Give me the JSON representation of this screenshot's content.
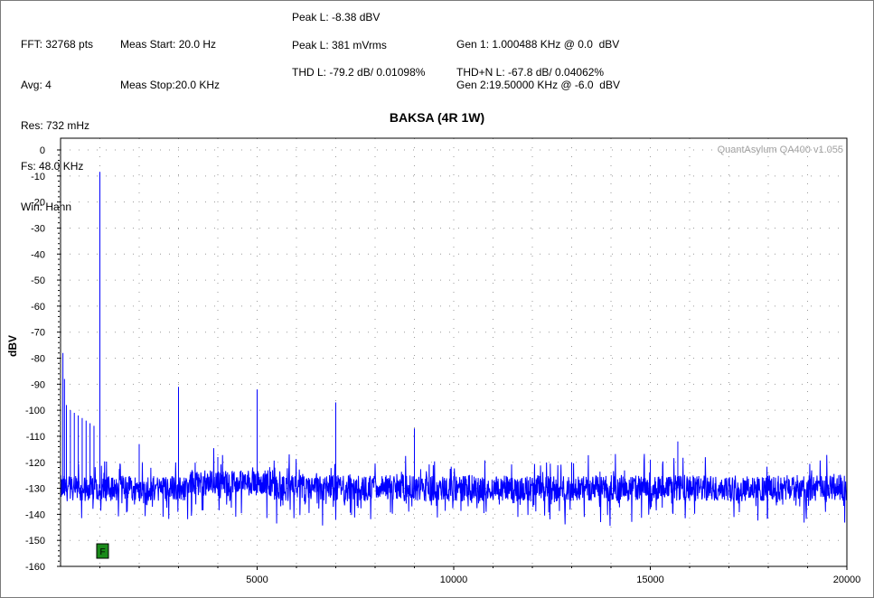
{
  "header": {
    "col1": [
      "FFT: 32768 pts",
      "Avg: 4",
      "Res: 732 mHz",
      "Fs: 48.0 KHz",
      "Win: Hann"
    ],
    "col2": [
      "Meas Start: 20.0 Hz",
      "Meas Stop:20.0 KHz"
    ],
    "col3": [
      "Peak L: -8.38 dBV",
      "Peak L: 381 mVrms",
      "THD L: -79.2 dB/ 0.01098%"
    ],
    "col4": [
      "Gen 1: 1.000488 KHz @ 0.0  dBV",
      "Gen 2:19.50000 KHz @ -6.0  dBV",
      "THD+N L: -67.8 dB/ 0.04062%"
    ]
  },
  "watermark": "QuantAsylum QA400 v1.055",
  "marker_label": "F",
  "chart_data": {
    "type": "line",
    "title": "BAKSA (4R 1W)",
    "xlabel": "",
    "ylabel": "dBV",
    "xlim": [
      0,
      20000
    ],
    "ylim": [
      -160,
      0
    ],
    "xticks": [
      5000,
      10000,
      15000,
      20000
    ],
    "yticks": [
      0,
      -10,
      -20,
      -30,
      -40,
      -50,
      -60,
      -70,
      -80,
      -90,
      -100,
      -110,
      -120,
      -130,
      -140,
      -150,
      -160
    ],
    "grid": true,
    "series_color": "#0000ff",
    "noise_floor": -130,
    "peaks": [
      {
        "x": 60,
        "y": -78
      },
      {
        "x": 100,
        "y": -88
      },
      {
        "x": 150,
        "y": -98
      },
      {
        "x": 250,
        "y": -100
      },
      {
        "x": 350,
        "y": -101
      },
      {
        "x": 450,
        "y": -102
      },
      {
        "x": 550,
        "y": -103
      },
      {
        "x": 650,
        "y": -104
      },
      {
        "x": 750,
        "y": -105
      },
      {
        "x": 850,
        "y": -106
      },
      {
        "x": 1000,
        "y": -8.4
      },
      {
        "x": 2000,
        "y": -113
      },
      {
        "x": 3000,
        "y": -91
      },
      {
        "x": 4000,
        "y": -118
      },
      {
        "x": 5000,
        "y": -92
      },
      {
        "x": 7000,
        "y": -97
      },
      {
        "x": 9000,
        "y": -107
      },
      {
        "x": 13000,
        "y": -120
      },
      {
        "x": 15000,
        "y": -119
      },
      {
        "x": 15700,
        "y": -112
      }
    ]
  }
}
